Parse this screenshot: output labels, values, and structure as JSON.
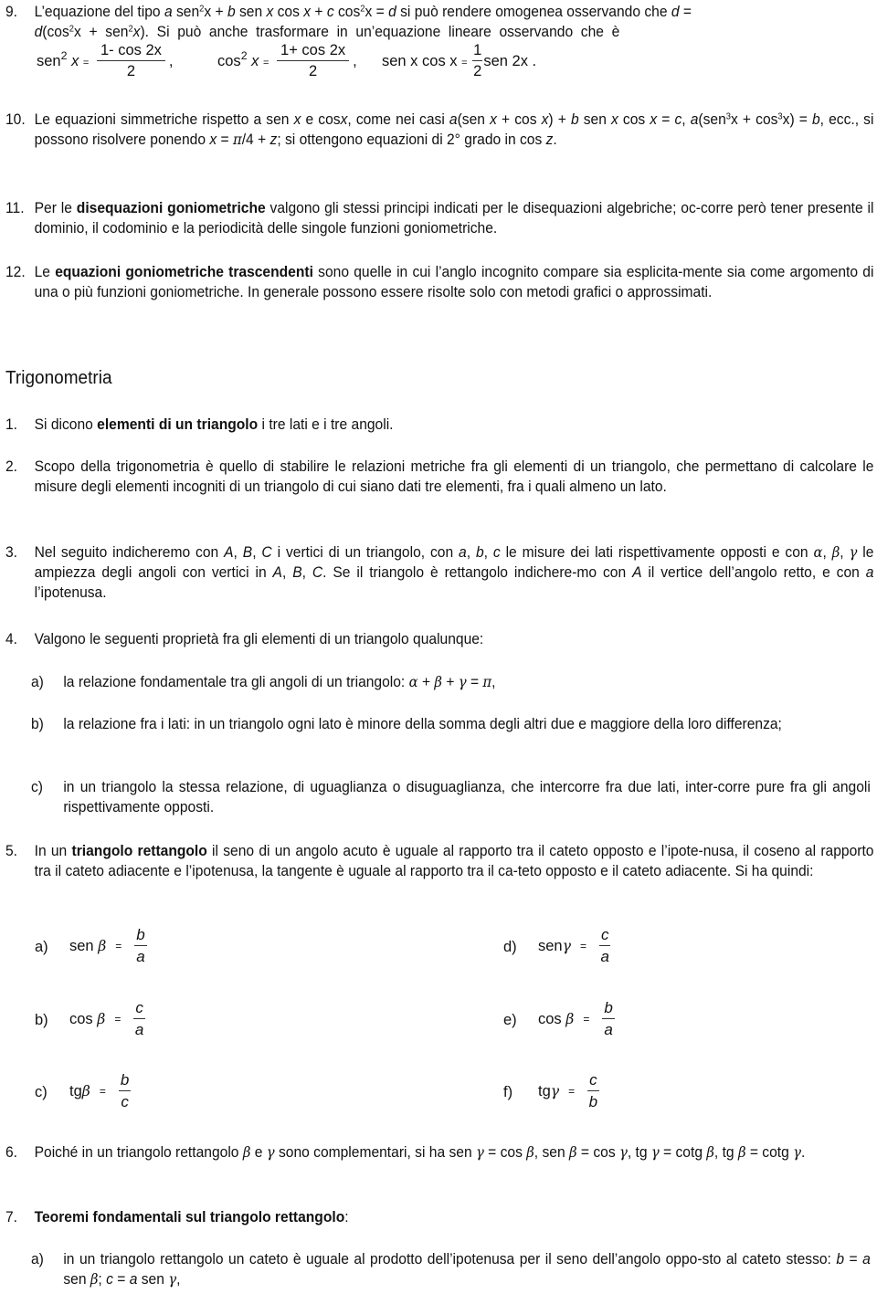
{
  "item9": {
    "number": "9.",
    "text_a": "L’equazione del tipo ",
    "text_b": "a",
    "text_c": " sen",
    "text_d": "x + ",
    "text_e": "b",
    "text_f": " sen ",
    "text_g": "x",
    "text_h": " cos ",
    "text_i": "x",
    "text_j": " + ",
    "text_k": "c",
    "text_l": " cos",
    "text_m": "x = ",
    "text_n": "d",
    "text_o": " si può rendere omogenea osservando che ",
    "text_p": "d",
    "text_q": " = ",
    "text_r": "d",
    "text_s": "(cos",
    "text_t": "x  +  sen",
    "text_u": "x",
    "text_v": ").  Si  può  anche  trasformare  in  un’equazione  lineare  osservando  che  è",
    "sup2": "2",
    "formulas": [
      {
        "lhs": "sen",
        "sup": "2",
        "var": "x",
        "eq": "=",
        "num": "1- cos 2x",
        "den": "2",
        "sep": ","
      },
      {
        "lhs": "cos",
        "sup": "2",
        "var": "x",
        "eq": "=",
        "num": "1+ cos 2x",
        "den": "2",
        "sep": ","
      },
      {
        "lhs": "sen x cos x",
        "eq": "=",
        "num": "1",
        "den": "2",
        "rhs": "sen 2x ."
      }
    ]
  },
  "item10": {
    "number": "10.",
    "t1": "Le equazioni simmetriche rispetto a sen ",
    "t2": "x",
    "t3": " e cos",
    "t4": "x",
    "t5": ", come nei casi ",
    "t6": "a",
    "t7": "(sen ",
    "t8": "x",
    "t9": " + cos ",
    "t10": "x",
    "t11": ") + ",
    "t12": "b",
    "t13": " sen ",
    "t14": "x",
    "t15": " cos ",
    "t16": "x",
    "t17": " = ",
    "t18": "c",
    "t19": ", ",
    "t20": "a",
    "t21": "(sen",
    "sup3": "3",
    "t22": "x + cos",
    "t23": "x) = ",
    "t24": "b",
    "t25": ", ecc., si possono risolvere ponendo ",
    "t26": "x",
    "t27": " = ",
    "t28": "π",
    "t29": "/4 + ",
    "t30": "z",
    "t31": "; si ottengono equazioni di 2° grado in cos ",
    "t32": "z",
    "t33": "."
  },
  "item11": {
    "number": "11.",
    "t1": "Per le ",
    "bold": "disequazioni goniometriche",
    "t2": " valgono gli stessi principi indicati per le disequazioni algebriche; oc-corre però tener presente il dominio, il codominio e la periodicità delle singole funzioni goniometriche."
  },
  "item12": {
    "number": "12.",
    "t1": "Le ",
    "bold": "equazioni goniometriche trascendenti",
    "t2": " sono quelle in cui l’anglo incognito compare sia esplicita-mente sia come argomento di una o più funzioni goniometriche. In generale possono essere risolte solo con metodi grafici o approssimati."
  },
  "heading": "Trigonometria",
  "t_item1": {
    "number": "1.",
    "t1": "Si dicono ",
    "bold": "elementi di un triangolo",
    "t2": " i tre lati e i tre angoli."
  },
  "t_item2": {
    "number": "2.",
    "text": "Scopo della trigonometria è quello di stabilire le relazioni metriche fra gli elementi di un triangolo, che permettano di calcolare le misure degli elementi incogniti di un triangolo di cui siano dati tre elementi, fra i quali almeno un lato."
  },
  "t_item3": {
    "number": "3.",
    "t1": "Nel seguito indicheremo con ",
    "A": "A",
    "c1": ", ",
    "B": "B",
    "c2": ", ",
    "C": "C",
    "t2": " i vertici di un triangolo, con ",
    "a": "a",
    "c3": ", ",
    "b": "b",
    "c4": ", ",
    "c": "c",
    "t3": " le misure dei lati rispettivamente opposti e con ",
    "alpha": "α",
    "c5": ", ",
    "beta": "β",
    "c6": ", ",
    "gamma": "γ",
    "t4": " le ampiezza degli angoli con vertici in ",
    "A2": "A",
    "c7": ", ",
    "B2": "B",
    "c8": ", ",
    "C2": "C",
    "t5": ". Se il triangolo è rettangolo indichere-mo con ",
    "A3": "A",
    "t6": " il vertice dell’angolo retto, e con ",
    "a2": "a",
    "t7": " l’ipotenusa."
  },
  "t_item4": {
    "number": "4.",
    "text": "Valgono le seguenti proprietà fra gli elementi di un triangolo qualunque:",
    "subs": [
      {
        "letter": "a)",
        "t1": "la relazione fondamentale tra gli angoli di un triangolo: ",
        "formula_alpha": "α",
        "p1": " + ",
        "formula_beta": "β",
        "p2": " + ",
        "formula_gamma": "γ",
        "p3": " = ",
        "formula_pi": "π",
        "p4": ","
      },
      {
        "letter": "b)",
        "text": "la relazione fra i lati: in un triangolo ogni lato è minore della somma degli altri due e maggiore della loro differenza;"
      },
      {
        "letter": "c)",
        "text": "in un triangolo la stessa relazione, di uguaglianza o disuguaglianza, che intercorre fra due lati, inter-corre pure fra gli angoli rispettivamente opposti."
      }
    ]
  },
  "t_item5": {
    "number": "5.",
    "t1": "In un ",
    "bold": "triangolo rettangolo",
    "t2": " il seno di un angolo acuto è uguale al rapporto tra il cateto opposto e l’ipote-nusa, il coseno al rapporto tra il cateto adiacente e l’ipotenusa, la tangente è uguale al rapporto tra il ca-teto opposto e il cateto adiacente. Si ha quindi:",
    "ratios": [
      {
        "letter": "a)",
        "fn": "sen",
        "angle": "β",
        "eq": "=",
        "num": "b",
        "den": "a"
      },
      {
        "letter": "b)",
        "fn": "cos",
        "angle": "β",
        "eq": "=",
        "num": "c",
        "den": "a"
      },
      {
        "letter": "c)",
        "fn": "tg",
        "angle": "β",
        "eq": "=",
        "num": "b",
        "den": "c"
      },
      {
        "letter": "d)",
        "fn": "sen",
        "angle": "γ",
        "eq": "=",
        "num": "c",
        "den": "a"
      },
      {
        "letter": "e)",
        "fn": "cos",
        "angle": "β",
        "eq": "=",
        "num": "b",
        "den": "a"
      },
      {
        "letter": "f)",
        "fn": "tg",
        "angle": "γ",
        "eq": "=",
        "num": "c",
        "den": "b"
      }
    ]
  },
  "t_item6": {
    "number": "6.",
    "t1": "Poiché in un triangolo rettangolo ",
    "g1": "β",
    "t2": " e ",
    "g2": "γ",
    "t3": " sono complementari, si ha sen ",
    "g3": "γ",
    "t4": " = cos ",
    "g4": "β",
    "t5": ", sen ",
    "g5": "β",
    "t6": " = cos ",
    "g6": "γ",
    "t7": ", tg ",
    "g7": "γ",
    "t8": " = cotg ",
    "g8": "β",
    "t9": ", tg ",
    "g9": "β",
    "t10": " = cotg ",
    "g10": "γ",
    "t11": "."
  },
  "t_item7": {
    "number": "7.",
    "bold": "Teoremi fondamentali sul triangolo rettangolo",
    "t1": ":",
    "subs": [
      {
        "letter": "a)",
        "t1": "in un triangolo rettangolo un cateto è uguale al prodotto dell’ipotenusa per il seno dell’angolo oppo-sto al cateto stesso: ",
        "b": "b",
        "t2": " = ",
        "a": "a",
        "t3": " sen ",
        "beta": "β",
        "t4": "; ",
        "c": "c",
        "t5": " = ",
        "a2": "a",
        "t6": " sen ",
        "gamma": "γ",
        "t7": ","
      }
    ]
  }
}
